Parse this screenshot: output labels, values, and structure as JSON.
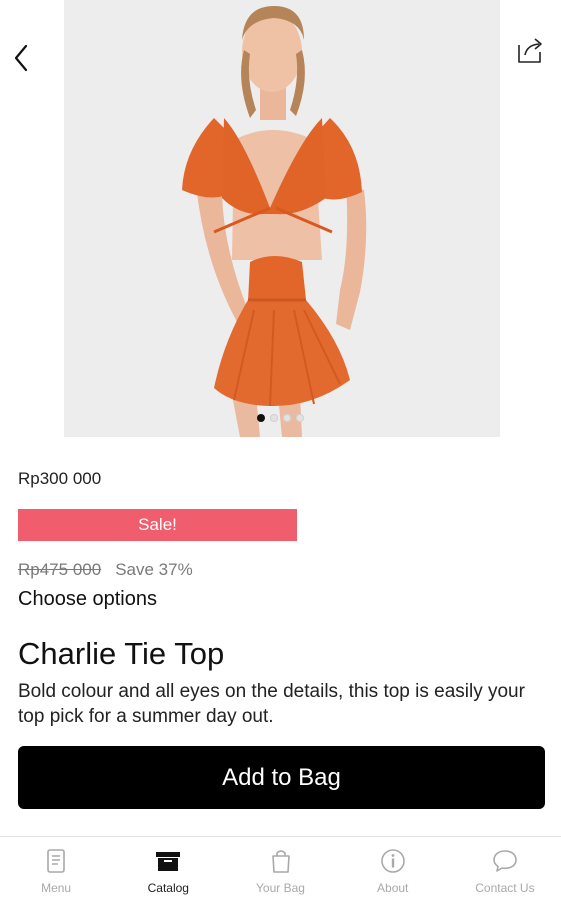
{
  "product": {
    "price": "Rp300 000",
    "sale_badge": "Sale!",
    "old_price": "Rp475 000",
    "savings": "Save 37%",
    "choose_options": "Choose options",
    "title": "Charlie Tie Top",
    "description": "Bold colour and all eyes on the details, this top is easily your top pick for a summer day out.",
    "add_to_bag": "Add to Bag",
    "image_count": 4,
    "active_image_index": 0
  },
  "icons": {
    "back": "chevron-left-icon",
    "share": "share-icon"
  },
  "tabbar": {
    "items": [
      {
        "label": "Menu",
        "icon": "menu-book-icon",
        "active": false
      },
      {
        "label": "Catalog",
        "icon": "catalog-box-icon",
        "active": true
      },
      {
        "label": "Your Bag",
        "icon": "shopping-bag-icon",
        "active": false
      },
      {
        "label": "About",
        "icon": "info-icon",
        "active": false
      },
      {
        "label": "Contact Us",
        "icon": "chat-bubble-icon",
        "active": false
      }
    ]
  },
  "colors": {
    "sale_badge": "#f05d6d",
    "primary_button": "#000000",
    "inactive_tab": "#a9a9a9",
    "garment": "#e2662a"
  }
}
